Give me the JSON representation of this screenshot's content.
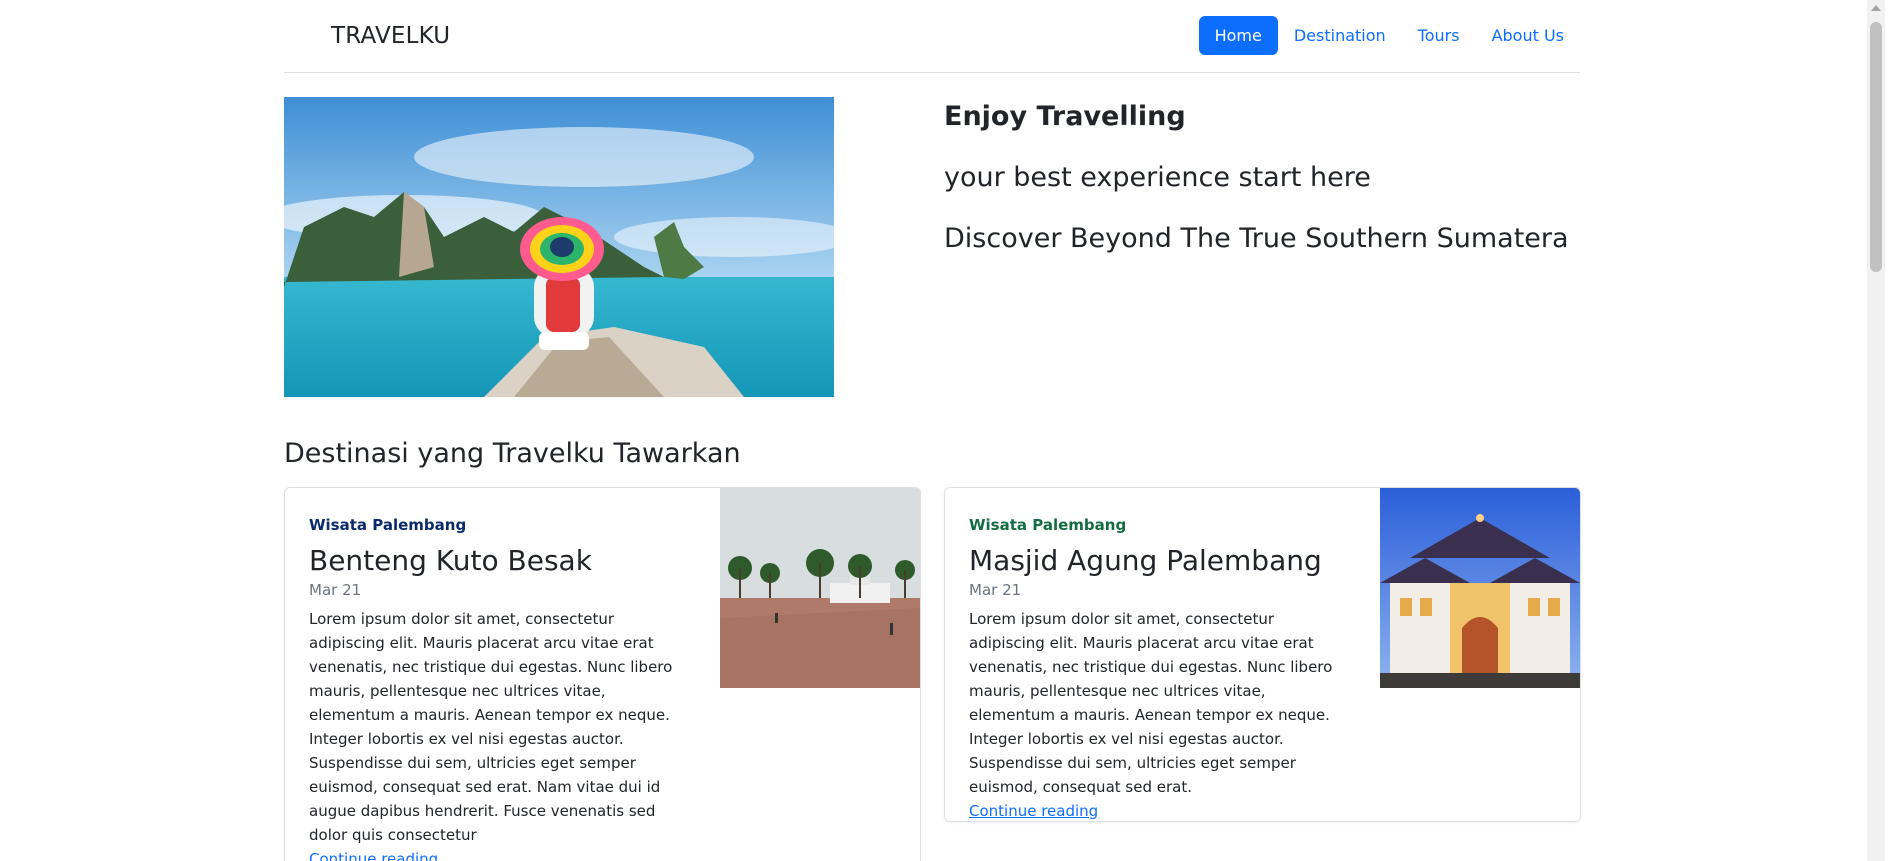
{
  "header": {
    "brand": "TRAVELKU",
    "nav": [
      {
        "label": "Home",
        "active": true
      },
      {
        "label": "Destination",
        "active": false
      },
      {
        "label": "Tours",
        "active": false
      },
      {
        "label": "About Us",
        "active": false
      }
    ]
  },
  "hero": {
    "title": "Enjoy Travelling",
    "subtitle1": "your best experience start here",
    "subtitle2": "Discover Beyond The True Southern Sumatera"
  },
  "section": {
    "title": "Destinasi yang Travelku Tawarkan"
  },
  "cards": [
    {
      "category": "Wisata Palembang",
      "title": "Benteng Kuto Besak",
      "date": "Mar 21",
      "text": "Lorem ipsum dolor sit amet, consectetur adipiscing elit. Mauris placerat arcu vitae erat venenatis, nec tristique dui egestas. Nunc libero mauris, pellentesque nec ultrices vitae, elementum a mauris. Aenean tempor ex neque. Integer lobortis ex vel nisi egestas auctor. Suspendisse dui sem, ultricies eget semper euismod, consequat sed erat. Nam vitae dui id augue dapibus hendrerit. Fusce venenatis sed dolor quis consectetur",
      "link": "Continue reading"
    },
    {
      "category": "Wisata Palembang",
      "title": "Masjid Agung Palembang",
      "date": "Mar 21",
      "text": "Lorem ipsum dolor sit amet, consectetur adipiscing elit. Mauris placerat arcu vitae erat venenatis, nec tristique dui egestas. Nunc libero mauris, pellentesque nec ultrices vitae, elementum a mauris. Aenean tempor ex neque. Integer lobortis ex vel nisi egestas auctor. Suspendisse dui sem, ultricies eget semper euismod, consequat sed erat.",
      "link": "Continue reading"
    }
  ],
  "colors": {
    "primary": "#0d6efd",
    "text": "#212529",
    "muted": "#6c757d"
  }
}
